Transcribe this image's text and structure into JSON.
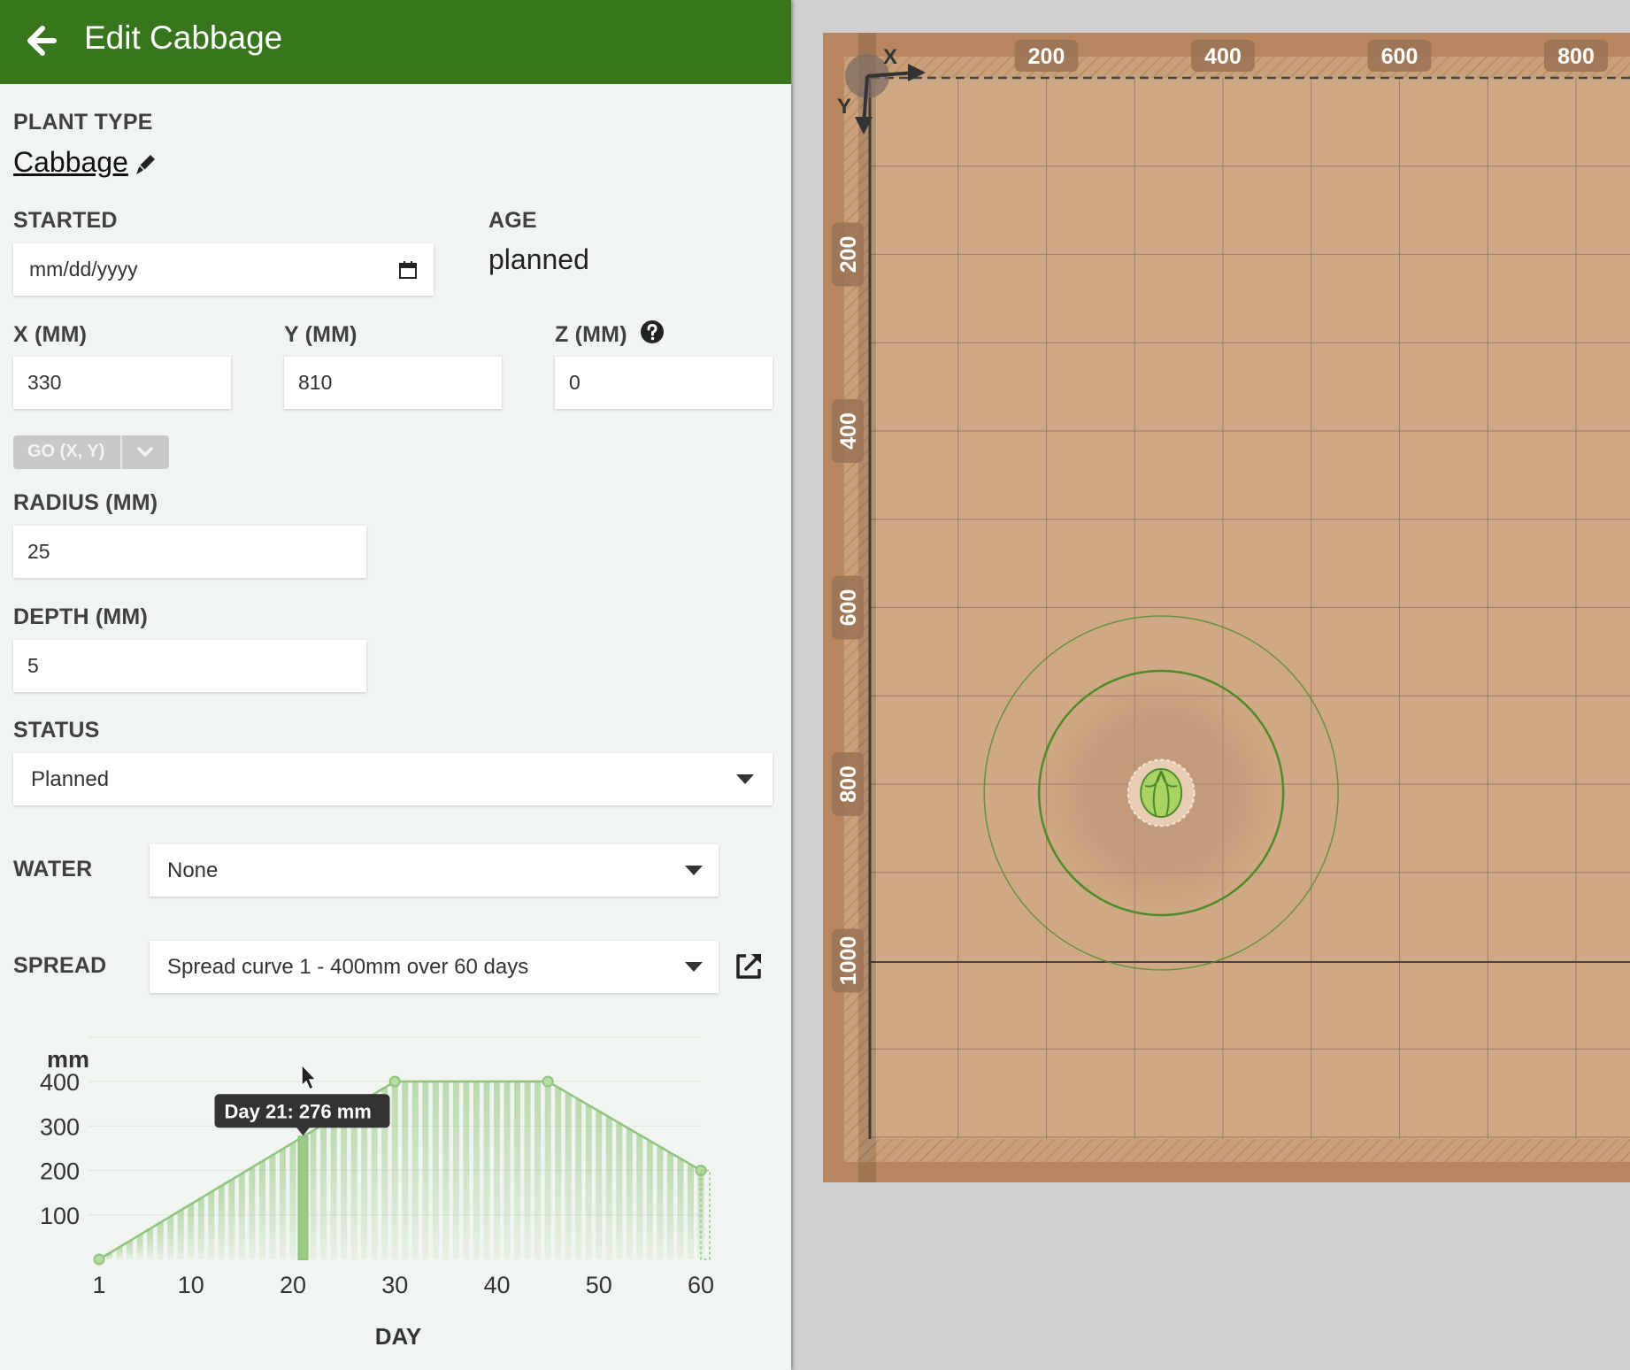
{
  "header": {
    "title": "Edit Cabbage",
    "back_icon": "arrow-left-icon"
  },
  "plant_type": {
    "label": "PLANT TYPE",
    "value": "Cabbage",
    "edit_icon": "pencil-icon"
  },
  "started": {
    "label": "STARTED",
    "placeholder": "mm/dd/yyyy",
    "calendar_icon": "calendar-icon"
  },
  "age": {
    "label": "AGE",
    "value": "planned"
  },
  "coords": {
    "x": {
      "label": "X (MM)",
      "value": "330"
    },
    "y": {
      "label": "Y (MM)",
      "value": "810"
    },
    "z": {
      "label": "Z (MM)",
      "value": "0",
      "help_icon": "question-circle-icon"
    }
  },
  "go_button": {
    "label": "GO (X, Y)"
  },
  "radius": {
    "label": "RADIUS (MM)",
    "value": "25"
  },
  "depth": {
    "label": "DEPTH (MM)",
    "value": "5"
  },
  "status": {
    "label": "STATUS",
    "selected": "Planned"
  },
  "water": {
    "label": "WATER",
    "selected": "None"
  },
  "spread": {
    "label": "SPREAD",
    "selected": "Spread curve 1 - 400mm over 60 days",
    "external_icon": "external-link-icon"
  },
  "chart_data": {
    "type": "area",
    "ylabel": "mm",
    "xlabel": "DAY",
    "x": [
      1,
      30,
      45,
      60
    ],
    "y": [
      0,
      400,
      400,
      200
    ],
    "xticks": [
      1,
      10,
      20,
      30,
      40,
      50,
      60
    ],
    "yticks": [
      100,
      200,
      300,
      400
    ],
    "xlim": [
      1,
      60
    ],
    "ylim": [
      0,
      400
    ],
    "tooltip": {
      "text": "Day 21: 276 mm",
      "day": 21,
      "value": 276
    },
    "colors": {
      "fill": "#8fc47a",
      "line": "#8fc47a"
    }
  },
  "map": {
    "x_axis_label": "X",
    "y_axis_label": "Y",
    "x_ticks": [
      "200",
      "400",
      "600",
      "800"
    ],
    "y_ticks": [
      "200",
      "400",
      "600",
      "800",
      "1000"
    ],
    "plant": {
      "icon": "cabbage-icon",
      "x_mm": 330,
      "y_mm": 810,
      "radius_mm": 25
    },
    "colors": {
      "soil": "#cfa985",
      "frame": "#b8875f",
      "grid": "#8f7458",
      "ring": "#4f8a2a"
    }
  }
}
